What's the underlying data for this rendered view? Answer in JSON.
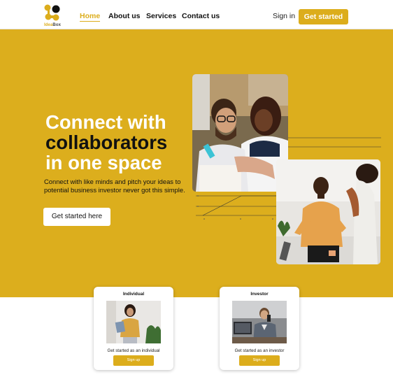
{
  "brand": {
    "logo_prefix": "Idea",
    "logo_suffix": "Box",
    "logo_icon": "connected-nodes-logo-icon",
    "accent_color": "#dcae1d"
  },
  "nav": {
    "links": [
      {
        "label": "Home",
        "active": true
      },
      {
        "label": "About us",
        "active": false
      },
      {
        "label": "Services",
        "active": false
      },
      {
        "label": "Contact us",
        "active": false
      }
    ],
    "signin_label": "Sign in",
    "cta_label": "Get started"
  },
  "hero": {
    "headline_line1": "Connect with",
    "headline_line2": "collaborators",
    "headline_line3": "in one space",
    "subtext": "Connect with like minds and pitch your ideas to potential business investor never got this simple.",
    "cta_label": "Get started here",
    "background_color": "#dcae1d",
    "images": [
      "collaborators-photo",
      "presentation-photo"
    ]
  },
  "cards": [
    {
      "title": "Individual",
      "description": "Get started as an individual",
      "button_label": "Sign up",
      "image": "individual-photo"
    },
    {
      "title": "Investor",
      "description": "Get started as an investor",
      "button_label": "Sign up",
      "image": "investor-photo"
    }
  ]
}
